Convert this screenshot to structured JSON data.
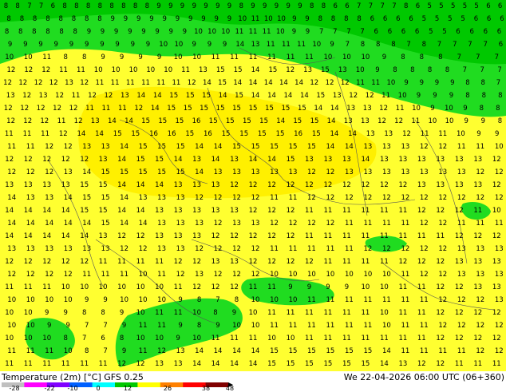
{
  "map": {
    "product": "Temperature (2m) [°C] GFS 0.25",
    "valid_time": "We 22-04-2026 06:00 UTC (06+360)",
    "field_rows": [
      "8 8 7 7 6 8 8 8 8 8 8 8 8 9 9 9 9 9 9 9 8 9 9 9 9 9 8 8 6 6 7 7 7 7 8 6 5 5 5 5 5 6 6",
      "8 8 8 8 8 8 8 8 9 9 9 9 9 9 9 9 9 9 10 11 10 10 9 9 8 8 8 8 6 6 6 6 5 5 5 5 6 6 6",
      "8 8 8 8 8 8 9 9 9 9 9 9 9 9 10 10 10 11 11 11 10 9 9 7 7 7 7 6 6 6 6 5 5 6 6 6 6",
      "9 9 9 9 9 9 9 9 9 9 10 10 9 9 9 14 13 11 11 11 10 9 7 8 8 8 7 8 7 7 7 7 6",
      "10 10 11 8 8 9 9 9 9 10 10 11 11 11 11 11 11 10 10 10 9 8 8 8 7 7 7",
      "12 12 12 11 11 10 10 10 10 10 11 13 15 15 14 15 12 13 15 13 10 9 8 8 8 8 7 7 7",
      "12 12 12 12 13 12 11 11 11 11 11 11 12 14 15 14 14 14 14 14 12 12 12 11 11 10 9 9 9 9 8 8 7",
      "13 12 13 12 11 12 12 13 14 14 15 15 15 14 15 14 14 14 14 15 13 12 12 11 10 9 9 9 8 8 8",
      "12 12 12 12 12 11 11 11 12 14 15 15 15 15 15 15 15 15 15 14 14 13 13 12 11 10 9 10 9 8 8",
      "12 12 12 11 12 13 14 14 15 15 15 16 15 15 15 15 14 15 15 14 13 13 12 12 11 10 10 9 9 8",
      "11 11 11 12 14 14 15 15 16 16 15 16 15 15 15 15 16 15 14 14 13 13 12 11 11 10 9 9",
      "11 11 12 12 13 13 14 15 15 15 14 14 15 15 15 15 15 14 14 13 13 13 12 12 11 11 10",
      "12 12 12 12 12 13 14 15 15 14 13 14 13 14 14 15 13 13 13 14 13 13 13 13 13 13 12",
      "12 12 12 13 14 15 15 15 15 15 14 13 13 13 13 13 12 12 13 13 13 13 13 13 13 12 12",
      "13 13 13 13 15 15 14 14 14 13 13 13 12 12 12 12 12 12 12 12 12 12 13 13 13 13 12",
      "14 13 13 14 15 15 14 13 13 13 12 12 12 12 11 11 12 12 12 12 12 12 12 12 12 12 12",
      "14 14 14 14 15 15 14 14 13 13 13 13 13 12 12 12 11 11 11 11 11 11 12 12 12 11 10",
      "14 14 14 14 14 15 14 14 13 13 13 12 13 13 12 12 12 12 11 11 11 11 12 12 11 11 11",
      "14 14 14 14 14 13 12 12 13 13 13 12 12 12 12 12 11 11 11 11 11 11 11 11 12 12 12",
      "13 13 13 13 13 13 12 12 13 13 12 12 12 12 11 11 11 11 11 12 12 12 12 12 13 13 13",
      "12 12 12 12 12 11 11 11 11 12 12 13 13 12 12 12 12 11 11 11 11 12 12 12 13 13 13",
      "12 12 12 12 11 11 11 10 11 12 13 12 12 12 10 10 10 10 10 10 10 11 12 12 13 13 13",
      "11 11 11 10 10 10 10 10 10 11 12 12 12 11 11 9 9 9 9 10 10 11 11 12 12 13 13",
      "10 10 10 10 9 9 10 10 10 9 8 7 8 10 10 10 11 11 11 11 11 11 11 12 12 12 13",
      "10 10 9 9 8 8 9 10 11 11 10 8 9 10 11 11 11 11 11 11 10 11 11 12 12 12 12",
      "10 10 9 9 7 7 9 11 11 9 8 9 10 10 11 11 11 11 11 11 10 11 11 12 12 12 12",
      "10 10 10 8 7 6 8 10 10 9 10 11 11 11 10 10 11 11 11 11 11 11 11 12 12 12 12",
      "11 11 11 10 8 7 9 11 12 13 14 14 14 14 15 15 15 15 15 15 14 11 11 11 11 12 12",
      "11 11 11 11 11 11 12 12 13 13 14 14 14 14 15 15 15 15 15 15 14 13 12 12 11 11 11"
    ]
  },
  "legend": {
    "ticks": [
      "-28",
      "-22",
      "-10",
      "0",
      "12",
      "26",
      "38",
      "48"
    ]
  },
  "colors": {
    "warm_13_plus": "#fff000",
    "mild_11_12": "#ffff30",
    "cool_9_10": "#20dc20",
    "cold_8_below": "#00c800",
    "borders": "#555555",
    "legend_stops": [
      "#c0c0c0",
      "#ff00ff",
      "#8000ff",
      "#0060ff",
      "#00ffff",
      "#00c800",
      "#ffff00",
      "#ff8000",
      "#ff0000",
      "#800000"
    ]
  }
}
